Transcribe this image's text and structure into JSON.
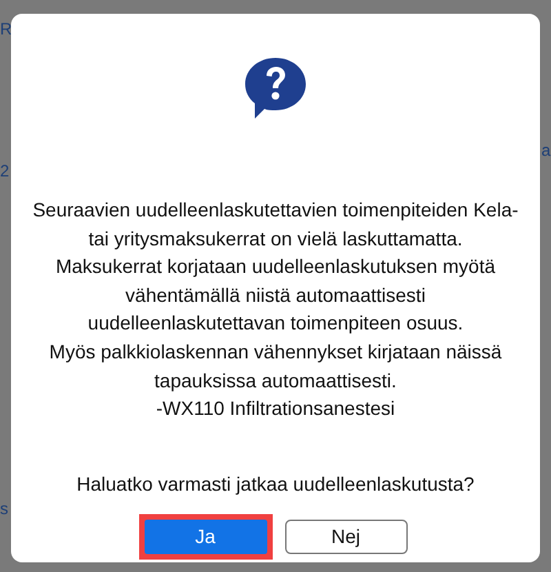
{
  "backdrop": {
    "fragments": [
      "R",
      "2",
      "a",
      "s"
    ]
  },
  "dialog": {
    "message_lines": [
      "Seuraavien uudelleenlaskutettavien toimenpiteiden Kela-",
      "tai yritysmaksukerrat on vielä laskuttamatta.",
      "Maksukerrat korjataan uudelleenlaskutuksen myötä",
      "vähentämällä niistä automaattisesti",
      "uudelleenlaskutettavan toimenpiteen osuus.",
      "Myös palkkiolaskennan vähennykset kirjataan näissä",
      "tapauksissa automaattisesti.",
      "-WX110 Infiltrationsanestesi"
    ],
    "question": "Haluatko varmasti jatkaa uudelleenlaskutusta?",
    "buttons": [
      {
        "label": "Ja",
        "kind": "primary",
        "highlighted": true
      },
      {
        "label": "Nej",
        "kind": "secondary",
        "highlighted": false
      }
    ]
  }
}
